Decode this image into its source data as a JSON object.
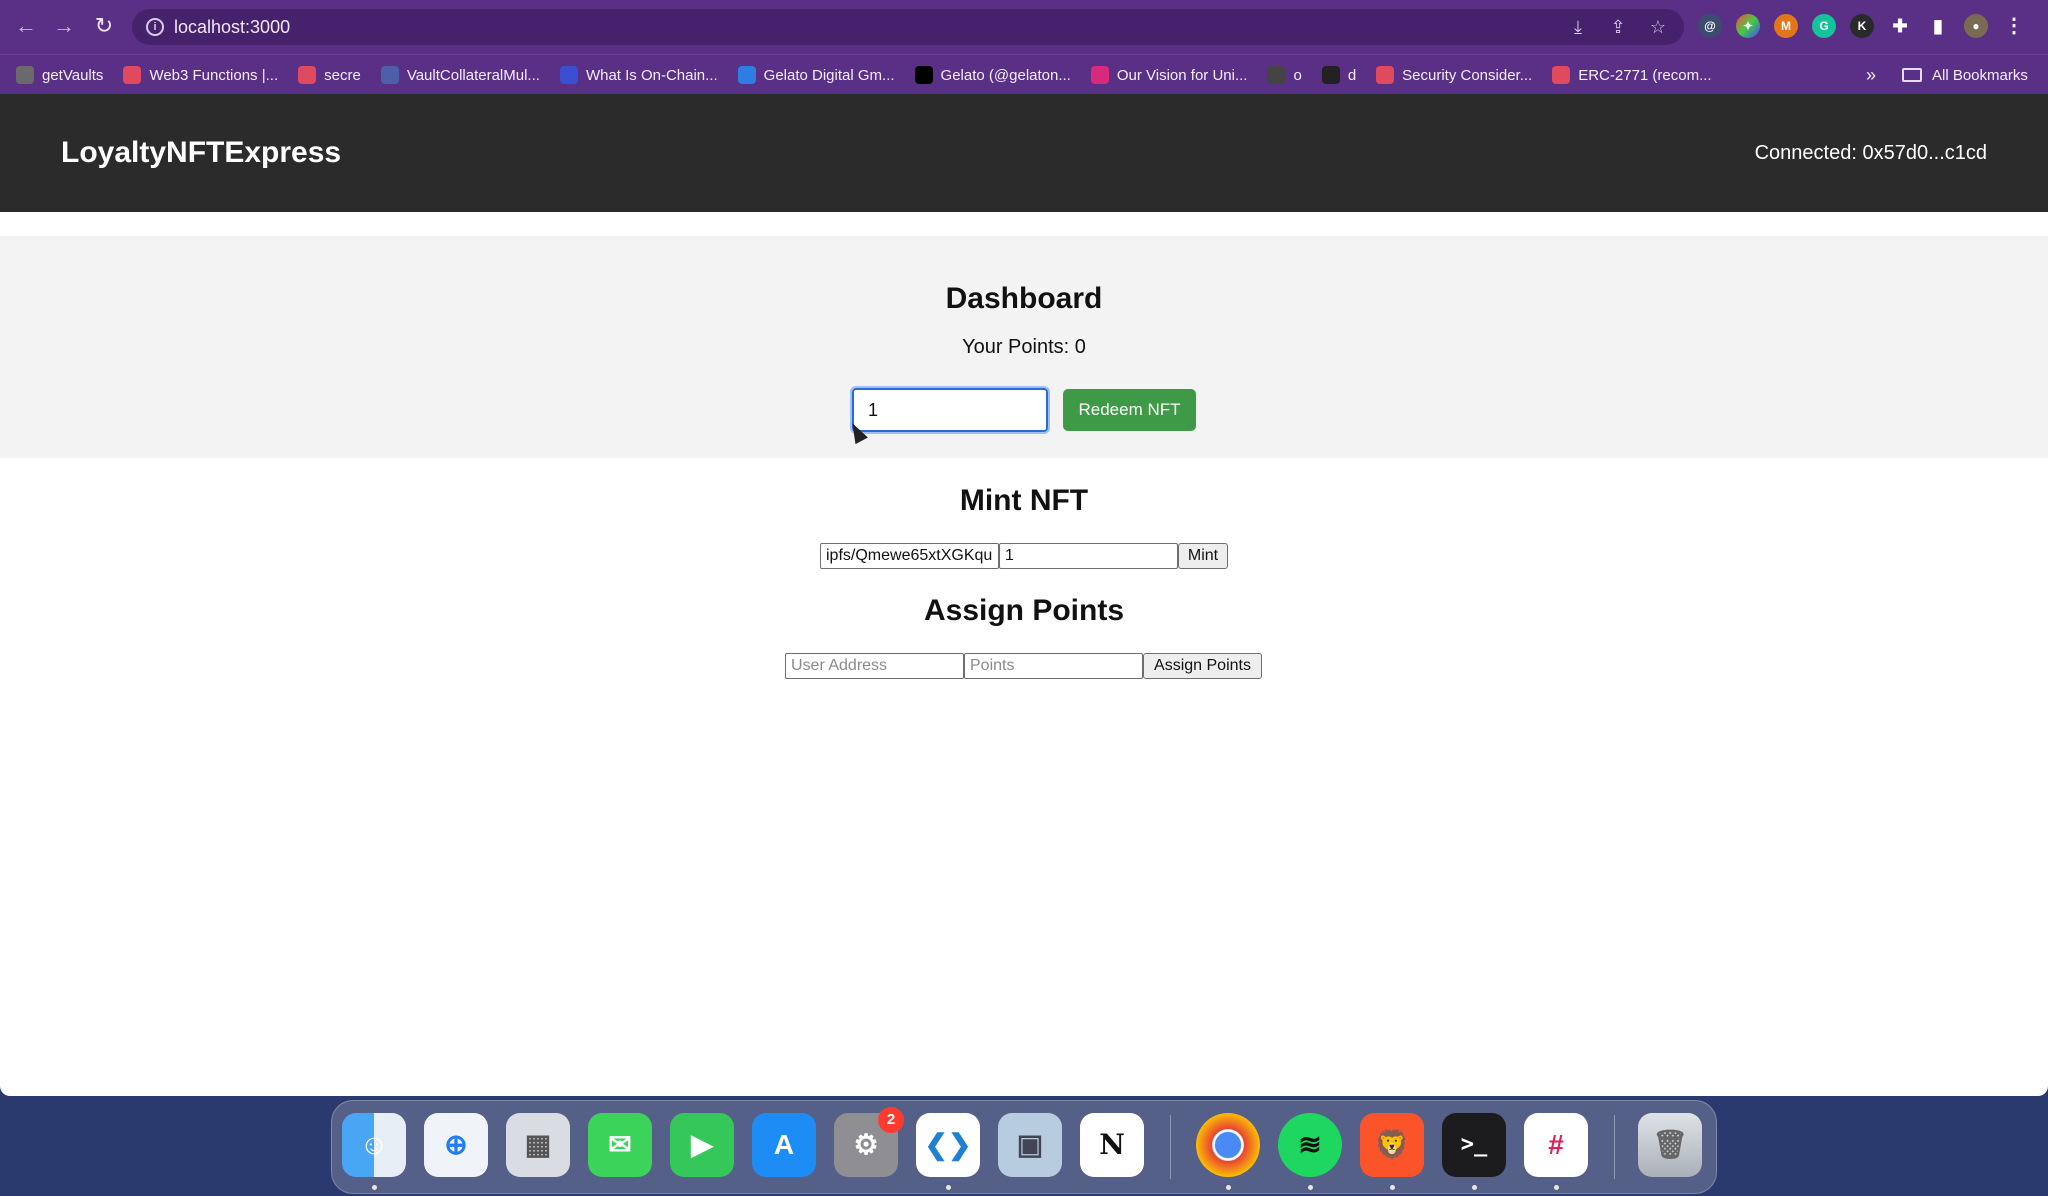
{
  "browser": {
    "url": "localhost:3000",
    "bookmarks": [
      {
        "label": "getVaults",
        "icon": "getvaults-favicon",
        "color": "#6a6a6a"
      },
      {
        "label": "Web3 Functions |...",
        "icon": "gelato-favicon",
        "color": "#e04a5f"
      },
      {
        "label": "secre",
        "icon": "gelato-favicon",
        "color": "#e04a5f"
      },
      {
        "label": "VaultCollateralMul...",
        "icon": "doc-favicon",
        "color": "#4d5fa8"
      },
      {
        "label": "What Is On-Chain...",
        "icon": "circle-favicon",
        "color": "#3a4fd0"
      },
      {
        "label": "Gelato Digital Gm...",
        "icon": "calendar-favicon",
        "color": "#2e7de0"
      },
      {
        "label": "Gelato (@gelaton...",
        "icon": "x-favicon",
        "color": "#000000"
      },
      {
        "label": "Our Vision for Uni...",
        "icon": "uniswap-favicon",
        "color": "#d9297a"
      },
      {
        "label": "o",
        "icon": "globe-favicon",
        "color": "#444444"
      },
      {
        "label": "d",
        "icon": "github-favicon",
        "color": "#222222"
      },
      {
        "label": "Security Consider...",
        "icon": "gelato-favicon",
        "color": "#e04a5f"
      },
      {
        "label": "ERC-2771 (recom...",
        "icon": "gelato-favicon",
        "color": "#e04a5f"
      }
    ],
    "more": "»",
    "all_bookmarks": "All Bookmarks"
  },
  "header": {
    "title": "LoyaltyNFTExpress",
    "connected": "Connected: 0x57d0...c1cd"
  },
  "dashboard": {
    "title": "Dashboard",
    "points": "Your Points: 0",
    "redeem_value": "1",
    "redeem_button": "Redeem NFT"
  },
  "mint": {
    "title": "Mint NFT",
    "uri_value": "ipfs/Qmewe65xtXGKqu",
    "amount_value": "1",
    "button": "Mint"
  },
  "assign": {
    "title": "Assign Points",
    "address_placeholder": "User Address",
    "points_placeholder": "Points",
    "button": "Assign Points"
  },
  "dock": {
    "settings_badge": "2"
  }
}
